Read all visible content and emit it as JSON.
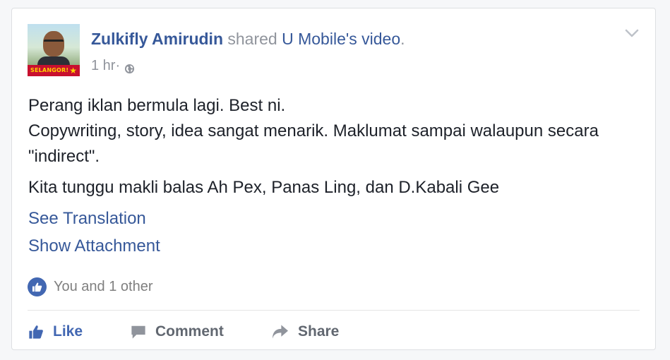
{
  "post": {
    "author": "Zulkifly Amirudin",
    "action_text": " shared ",
    "shared_source": "U Mobile's video",
    "trailing_punct": ".",
    "time": "1 hr",
    "time_separator": " · ",
    "avatar_banner": "SELANGOR!",
    "paragraphs": [
      "Perang iklan bermula lagi. Best ni.",
      "Copywriting, story, idea sangat menarik. Maklumat sampai walaupun secara \"indirect\".",
      "Kita tunggu makli balas Ah Pex, Panas Ling, dan D.Kabali Gee"
    ],
    "see_translation": "See Translation",
    "show_attachment": "Show Attachment",
    "reactions_text": "You and 1 other"
  },
  "actions": {
    "like": "Like",
    "comment": "Comment",
    "share": "Share"
  },
  "colors": {
    "link": "#365899",
    "text": "#1d2129",
    "muted": "#90949c",
    "like_active": "#4267b2"
  },
  "icons": [
    "globe-icon",
    "chevron-down-icon",
    "like-reaction-icon",
    "thumbs-up-icon",
    "comment-icon",
    "share-icon"
  ]
}
